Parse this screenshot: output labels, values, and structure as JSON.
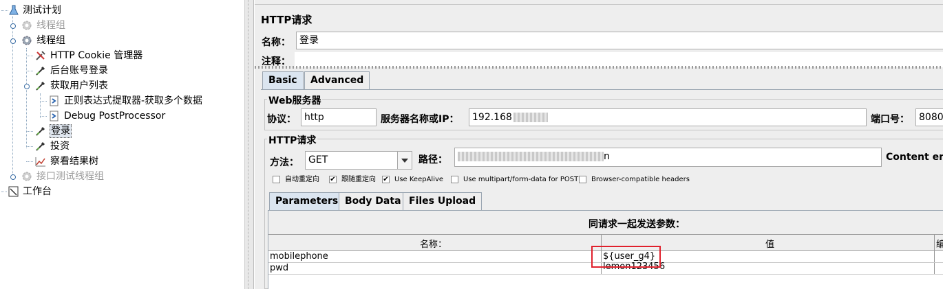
{
  "tree": {
    "items": [
      {
        "label": "测试计划",
        "icon": "flask-icon",
        "disabled": false,
        "selected": false
      },
      {
        "label": "线程组",
        "icon": "gear-icon",
        "disabled": true,
        "selected": false
      },
      {
        "label": "线程组",
        "icon": "gear-icon",
        "disabled": false,
        "selected": false
      },
      {
        "label": "HTTP Cookie 管理器",
        "icon": "wrench-icon",
        "disabled": false,
        "selected": false
      },
      {
        "label": "后台账号登录",
        "icon": "pipette-icon",
        "disabled": false,
        "selected": false
      },
      {
        "label": "获取用户列表",
        "icon": "pipette-icon",
        "disabled": false,
        "selected": false
      },
      {
        "label": "正则表达式提取器-获取多个数据",
        "icon": "postprocessor-icon",
        "disabled": false,
        "selected": false
      },
      {
        "label": "Debug PostProcessor",
        "icon": "postprocessor-icon",
        "disabled": false,
        "selected": false
      },
      {
        "label": "登录",
        "icon": "pipette-icon",
        "disabled": false,
        "selected": true
      },
      {
        "label": "投资",
        "icon": "pipette-icon",
        "disabled": false,
        "selected": false
      },
      {
        "label": "察看结果树",
        "icon": "chart-icon",
        "disabled": false,
        "selected": false
      },
      {
        "label": "接口测试线程组",
        "icon": "gear-icon",
        "disabled": true,
        "selected": false
      },
      {
        "label": "工作台",
        "icon": "workbench-icon",
        "disabled": false,
        "selected": false
      }
    ]
  },
  "panel": {
    "title": "HTTP请求",
    "name_label": "名称：",
    "name_value": "登录",
    "comment_label": "注释：",
    "tabs": [
      "Basic",
      "Advanced"
    ],
    "web_server": {
      "legend": "Web服务器",
      "protocol_label": "协议：",
      "protocol_value": "http",
      "server_label": "服务器名称或IP：",
      "server_value": "192.168",
      "port_label": "端口号：",
      "port_value": "8080"
    },
    "http_request": {
      "legend": "HTTP请求",
      "method_label": "方法：",
      "method_value": "GET",
      "path_label": "路径：",
      "path_value": "n",
      "content_label": "Content enc",
      "checkboxes": [
        {
          "label": "自动重定向",
          "checked": false
        },
        {
          "label": "跟随重定向",
          "checked": true
        },
        {
          "label": "Use KeepAlive",
          "checked": true
        },
        {
          "label": "Use multipart/form-data for POST",
          "checked": false
        },
        {
          "label": "Browser-compatible headers",
          "checked": false
        }
      ]
    },
    "sub_tabs": [
      "Parameters",
      "Body Data",
      "Files Upload"
    ],
    "params": {
      "caption": "同请求一起发送参数：",
      "columns": [
        "名称：",
        "值",
        "编"
      ],
      "rows": [
        {
          "name": "mobilephone",
          "value": "${user_g4}"
        },
        {
          "name": "pwd",
          "value": "lemon123456"
        }
      ]
    }
  },
  "colors": {
    "highlight_box": "#e0202c",
    "tab_active": "#dbe5f0",
    "panel_bg": "#eeeeee"
  }
}
